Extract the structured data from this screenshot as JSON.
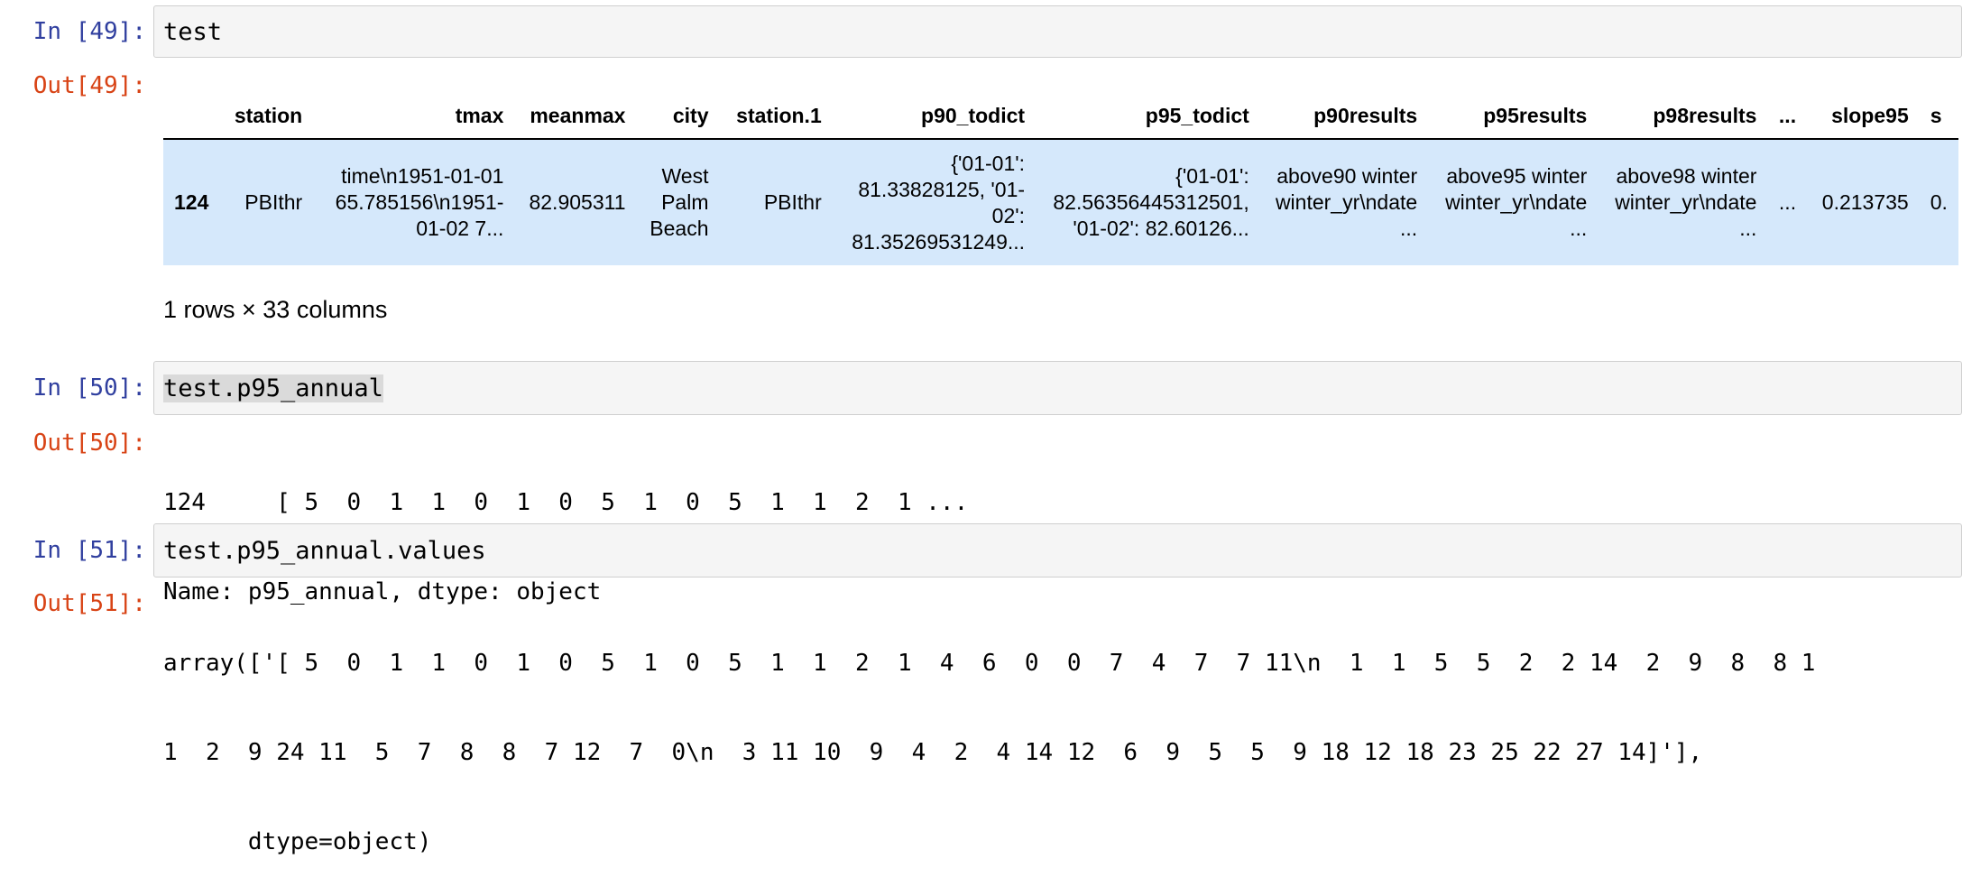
{
  "cells": [
    {
      "in_prompt": "In [49]:",
      "code": "test",
      "out_prompt": "Out[49]:",
      "dataframe": {
        "columns": [
          "",
          "station",
          "tmax",
          "meanmax",
          "city",
          "station.1",
          "p90_todict",
          "p95_todict",
          "p90results",
          "p95results",
          "p98results",
          "...",
          "slope95",
          "s"
        ],
        "rows": [
          {
            "index": "124",
            "values": [
              "PBIthr",
              "time\\n1951-01-01\n65.785156\\n1951-\n01-02 7...",
              "82.905311",
              "West\nPalm\nBeach",
              "PBIthr",
              "{'01-01':\n81.33828125, '01-\n02':\n81.35269531249...",
              "{'01-01':\n82.56356445312501,\n'01-02': 82.60126...",
              "above90 winter\nwinter_yr\\ndate\n...",
              "above95 winter\nwinter_yr\\ndate\n...",
              "above98 winter\nwinter_yr\\ndate\n...",
              "...",
              "0.213735",
              "0."
            ]
          }
        ],
        "shape_text": "1 rows × 33 columns"
      }
    },
    {
      "in_prompt": "In [50]:",
      "code": "test.p95_annual",
      "out_prompt": "Out[50]:",
      "output_lines": [
        "124     [ 5  0  1  1  0  1  0  5  1  0  5  1  1  2  1 ...",
        "Name: p95_annual, dtype: object"
      ]
    },
    {
      "in_prompt": "In [51]:",
      "code": "test.p95_annual.values",
      "out_prompt": "Out[51]:",
      "output_lines": [
        "array(['[ 5  0  1  1  0  1  0  5  1  0  5  1  1  2  1  4  6  0  0  7  4  7  7 11\\n  1  1  5  5  2  2 14  2  9  8  8 1",
        "1  2  9 24 11  5  7  8  8  7 12  7  0\\n  3 11 10  9  4  2  4 14 12  6  9  5  5  9 18 12 18 23 25 22 27 14]'],",
        "      dtype=object)"
      ]
    }
  ],
  "colors": {
    "in_prompt": "#303f9f",
    "out_prompt": "#d84315",
    "input_bg": "#f5f5f5",
    "row_highlight": "#d5e8fb"
  }
}
